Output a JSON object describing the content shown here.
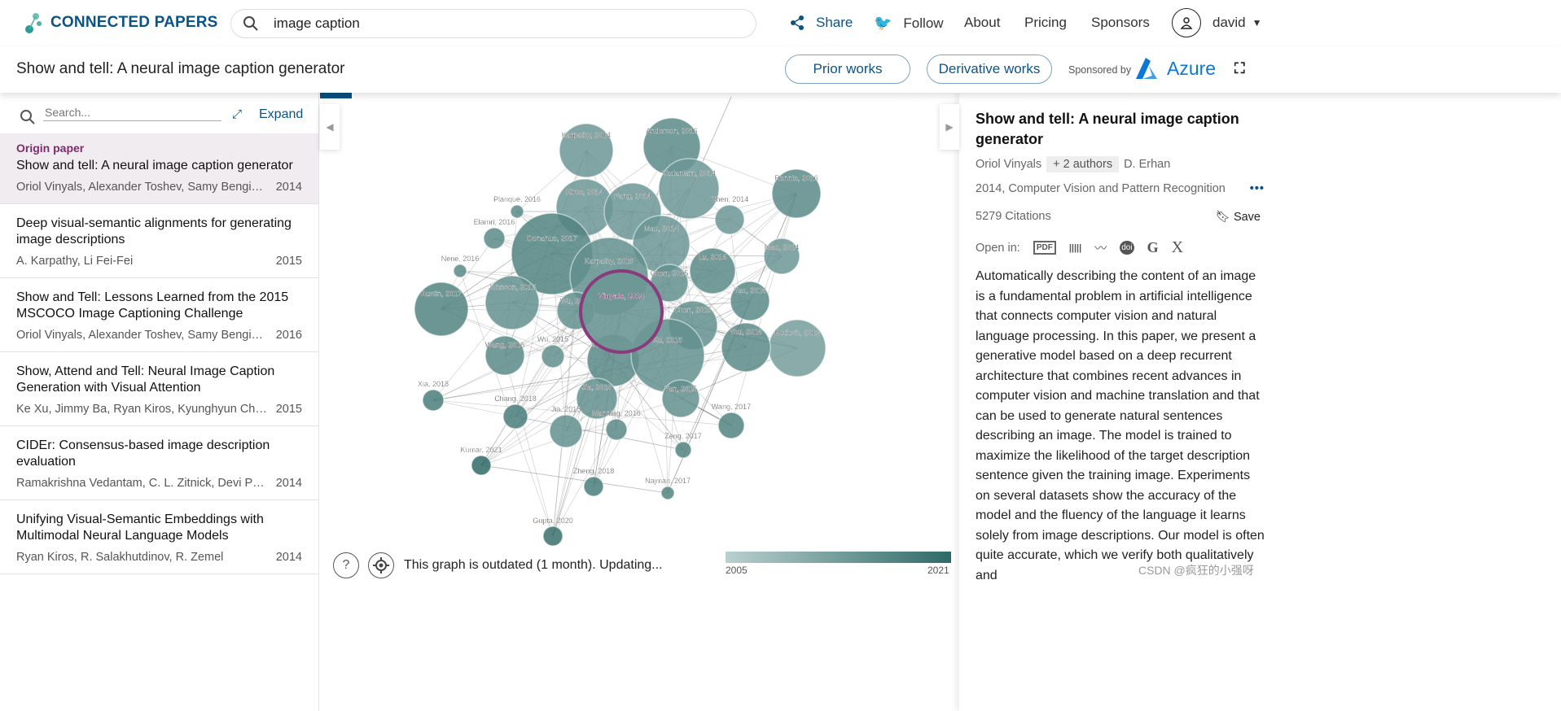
{
  "app": {
    "name": "CONNECTED PAPERS"
  },
  "header": {
    "search_value": "image caption",
    "share": "Share",
    "follow": "Follow",
    "about": "About",
    "pricing": "Pricing",
    "sponsors": "Sponsors",
    "user": "david"
  },
  "subbar": {
    "title": "Show and tell: A neural image caption generator",
    "prior": "Prior works",
    "derivative": "Derivative works",
    "sponsored_by": "Sponsored by",
    "sponsor": "Azure"
  },
  "left": {
    "search_placeholder": "Search...",
    "expand": "Expand",
    "origin_label": "Origin paper",
    "items": [
      {
        "title": "Show and tell: A neural image caption generator",
        "authors": "Oriol Vinyals, Alexander Toshev, Samy Bengio, D....",
        "year": "2014"
      },
      {
        "title": "Deep visual-semantic alignments for generating image descriptions",
        "authors": "A. Karpathy, Li Fei-Fei",
        "year": "2015"
      },
      {
        "title": "Show and Tell: Lessons Learned from the 2015 MSCOCO Image Captioning Challenge",
        "authors": "Oriol Vinyals, Alexander Toshev, Samy Bengio, D....",
        "year": "2016"
      },
      {
        "title": "Show, Attend and Tell: Neural Image Caption Generation with Visual Attention",
        "authors": "Ke Xu, Jimmy Ba, Ryan Kiros, Kyunghyun Cho,...",
        "year": "2015"
      },
      {
        "title": "CIDEr: Consensus-based image description evaluation",
        "authors": "Ramakrishna Vedantam, C. L. Zitnick, Devi Parikh",
        "year": "2014"
      },
      {
        "title": "Unifying Visual-Semantic Embeddings with Multimodal Neural Language Models",
        "authors": "Ryan Kiros, R. Salakhutdinov, R. Zemel",
        "year": "2014"
      }
    ]
  },
  "graph": {
    "nodes": [
      "Karpathy, 2014",
      "Anderson, 2016",
      "Vedantam, 2014",
      "Rennie, 2016",
      "Planque, 2016",
      "Kiros, 2014",
      "Fang, 2014",
      "Chen, 2014",
      "Elamri, 2016",
      "Donahue, 2017",
      "Mao, 2014",
      "Mao, 2014",
      "Karpathy, 2015",
      "Lu, 2016",
      "Chen, 2015",
      "Nene, 2016",
      "Johnson, 2015",
      "Austin, 2017",
      "Wu, 2015",
      "Yao, 2016",
      "Chen, 2015",
      "Hodosh, 2013",
      "Wang, 2016",
      "Wu, 2015",
      "Vinyals, 2016",
      "Xu, 2015",
      "You, 2016",
      "Xia, 2018",
      "Jia, 2015",
      "Yan, 2015",
      "Chang, 2018",
      "Jia, 2015",
      "Manning, 2016",
      "Wang, 2017",
      "Zeng, 2017",
      "Kumar, 2021",
      "Zheng, 2018",
      "Najman, 2017",
      "Gupta, 2020",
      "Vinyals, 2014"
    ],
    "origin": "Vinyals, 2014",
    "status": "This graph is outdated (1 month). Updating...",
    "legend_min": "2005",
    "legend_max": "2021",
    "colors": {
      "light": "#b9d0cf",
      "dark": "#2f6a67",
      "origin_ring": "#8a3b7c"
    }
  },
  "right": {
    "title": "Show and tell: A neural image caption generator",
    "author_first": "Oriol Vinyals",
    "more_authors": "+ 2 authors",
    "author_last": "D. Erhan",
    "venue": "2014, Computer Vision and Pattern Recognition",
    "citations": "5279 Citations",
    "save": "Save",
    "open_in": "Open in:",
    "open_icons": [
      "PDF",
      "arXiv",
      "S2",
      "doi",
      "G",
      "X"
    ],
    "abstract": "Automatically describing the content of an image is a fundamental problem in artificial intelligence that connects computer vision and natural language processing. In this paper, we present a generative model based on a deep recurrent architecture that combines recent advances in computer vision and machine translation and that can be used to generate natural sentences describing an image. The model is trained to maximize the likelihood of the target description sentence given the training image. Experiments on several datasets show the accuracy of the model and the fluency of the language it learns solely from image descriptions. Our model is often quite accurate, which we verify both qualitatively and"
  },
  "watermark": "CSDN @疯狂的小强呀"
}
